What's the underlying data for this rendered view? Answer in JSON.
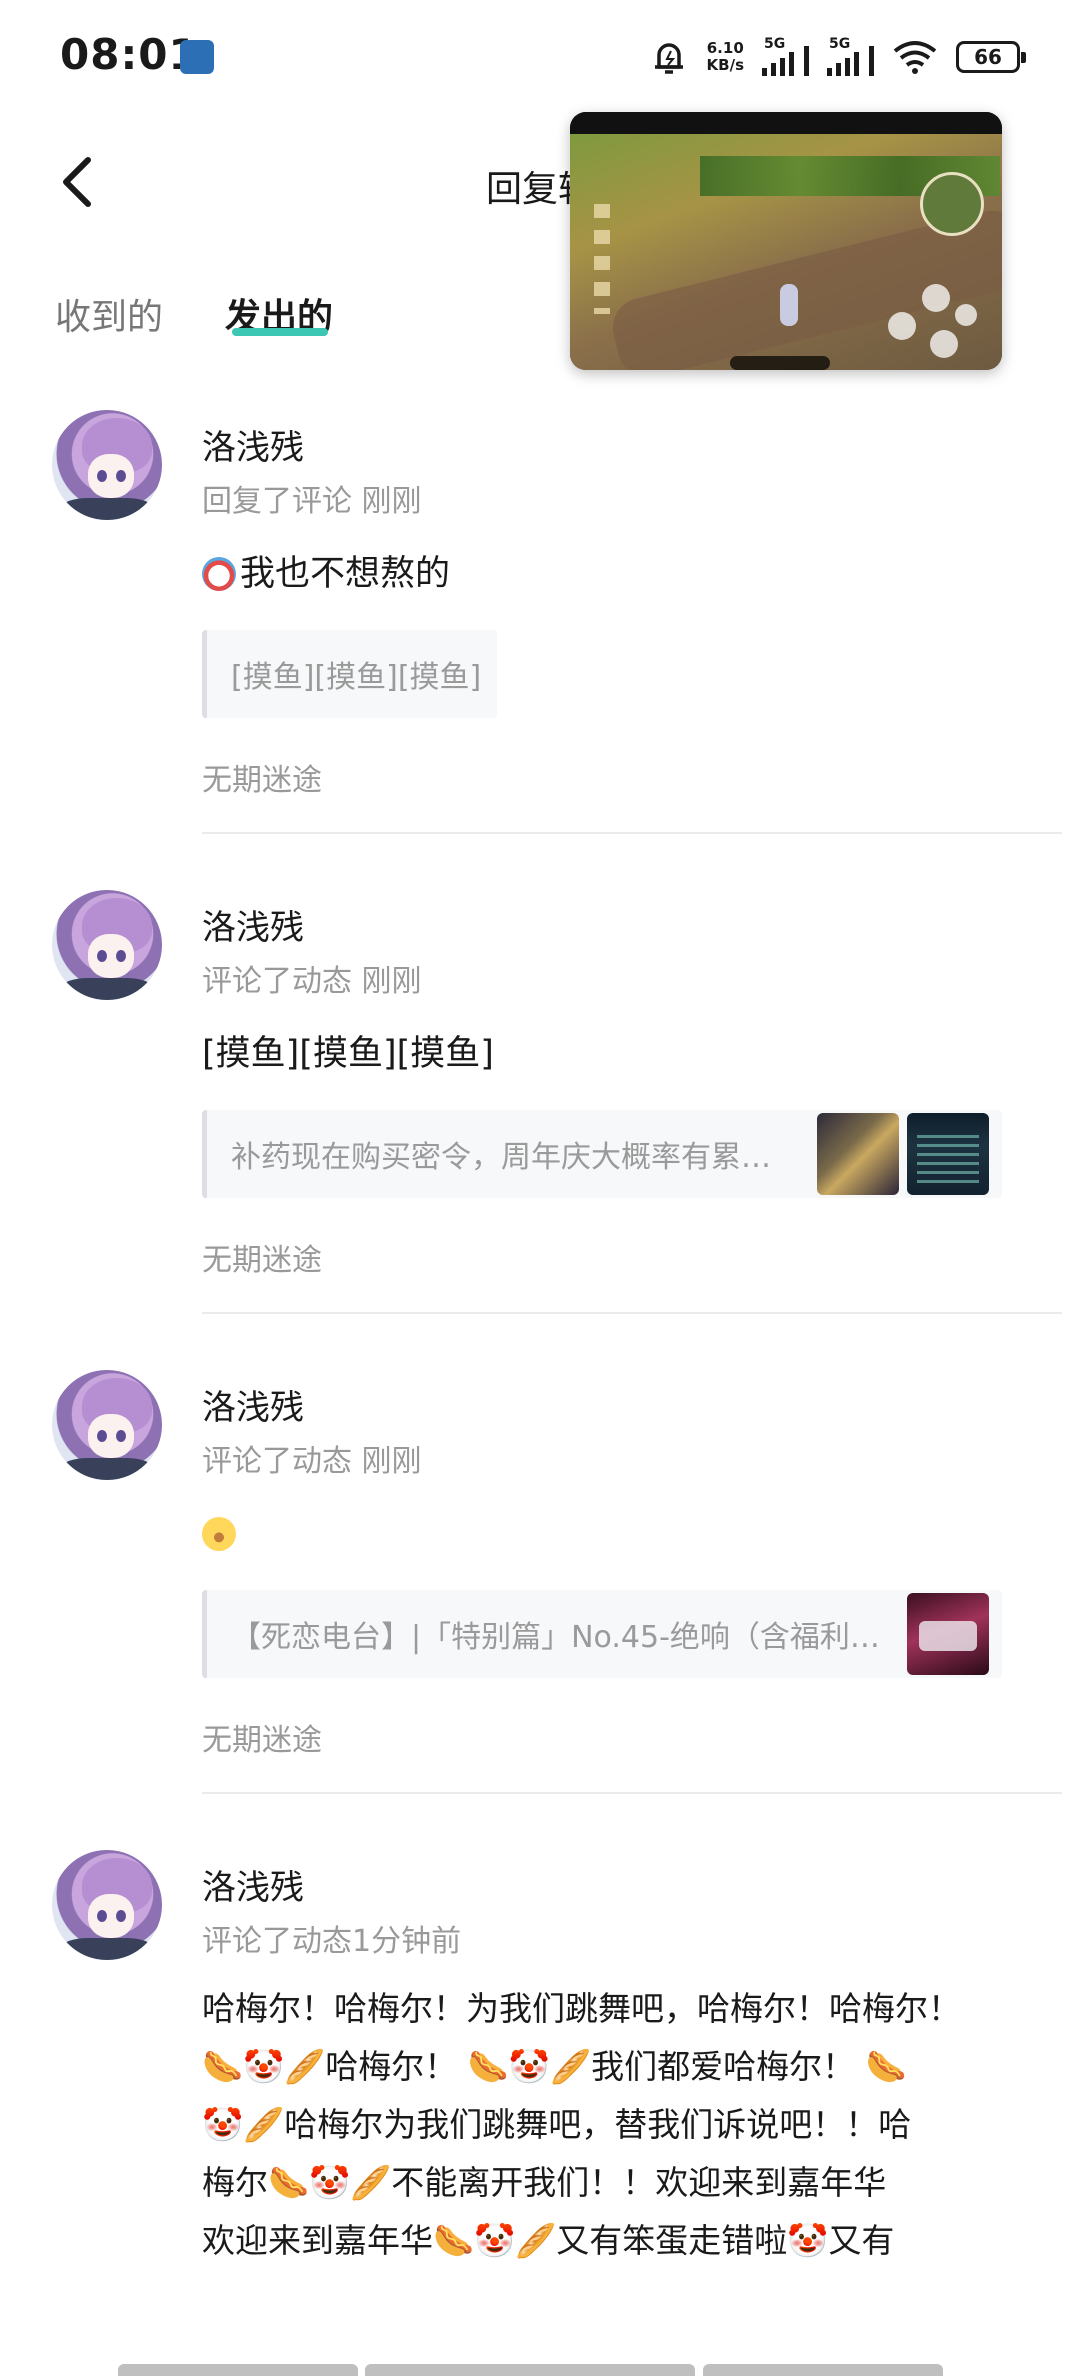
{
  "status_bar": {
    "time": "08:01",
    "net_speed_value": "6.10",
    "net_speed_unit": "KB/s",
    "sim1_label": "5G",
    "sim2_label": "5G",
    "battery": "66",
    "icons": [
      "app-notification-icon",
      "alarm-icon",
      "signal-icon",
      "wifi-icon",
      "battery-icon"
    ]
  },
  "header": {
    "title": "回复转"
  },
  "tabs": [
    {
      "label": "收到的",
      "active": false
    },
    {
      "label": "发出的",
      "active": true
    }
  ],
  "accent_color": "#3cc6b4",
  "items": [
    {
      "username": "洛浅残",
      "action": "回复了评论 刚刚",
      "content": "我也不想熬的",
      "quote": "[摸鱼][摸鱼][摸鱼]",
      "source": "无期迷途"
    },
    {
      "username": "洛浅残",
      "action": "评论了动态 刚刚",
      "content": "[摸鱼][摸鱼][摸鱼]",
      "quote": "补药现在购买密令，周年庆大概率有累…",
      "source": "无期迷途"
    },
    {
      "username": "洛浅残",
      "action": "评论了动态 刚刚",
      "content": "",
      "quote": "【死恋电台】|「特别篇」No.45-绝响（含福利…",
      "source": "无期迷途"
    },
    {
      "username": "洛浅残",
      "action": "评论了动态1分钟前",
      "content_lines": [
        "哈梅尔！哈梅尔！为我们跳舞吧，哈梅尔！哈梅尔！",
        "哈梅尔！",
        "我们都爱哈梅尔！",
        "哈梅尔为我们跳舞吧，替我们诉说吧！！哈",
        "梅尔",
        "不能离开我们！！欢迎来到嘉年华",
        "欢迎来到嘉年华",
        "又有笨蛋走错啦",
        "又有"
      ]
    }
  ]
}
